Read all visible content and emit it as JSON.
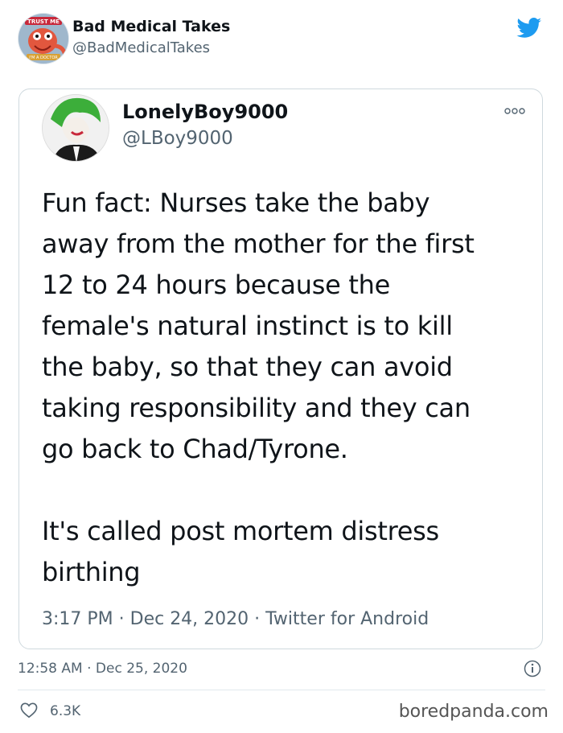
{
  "tweet": {
    "author_name": "Bad Medical Takes",
    "author_handle": "@BadMedicalTakes",
    "avatar_badge_text": "TRUST ME",
    "avatar_bottom_text": "I'M A DOCTOR",
    "timestamp": "12:58 AM · Dec 25, 2020",
    "like_count": "6.3K"
  },
  "quoted_tweet": {
    "author_name": "LonelyBoy9000",
    "author_handle": "@LBoy9000",
    "lines_para1": [
      "Fun fact: Nurses take the baby",
      "away from the mother for the first",
      "12 to 24 hours because the",
      "female's natural instinct is to kill",
      "the baby, so that they can avoid",
      "taking responsibility and they can",
      "go back to Chad/Tyrone."
    ],
    "lines_para2": [
      "It's called post mortem distress",
      "birthing"
    ],
    "meta": "3:17 PM · Dec 24, 2020 · Twitter for Android"
  },
  "icons": {
    "twitter": "twitter-bird-icon",
    "more": "more-options-icon",
    "info": "info-icon",
    "like": "heart-icon"
  },
  "watermark": "boredpanda.com",
  "colors": {
    "twitter_blue": "#1d9bf0",
    "muted_text": "#536471"
  }
}
